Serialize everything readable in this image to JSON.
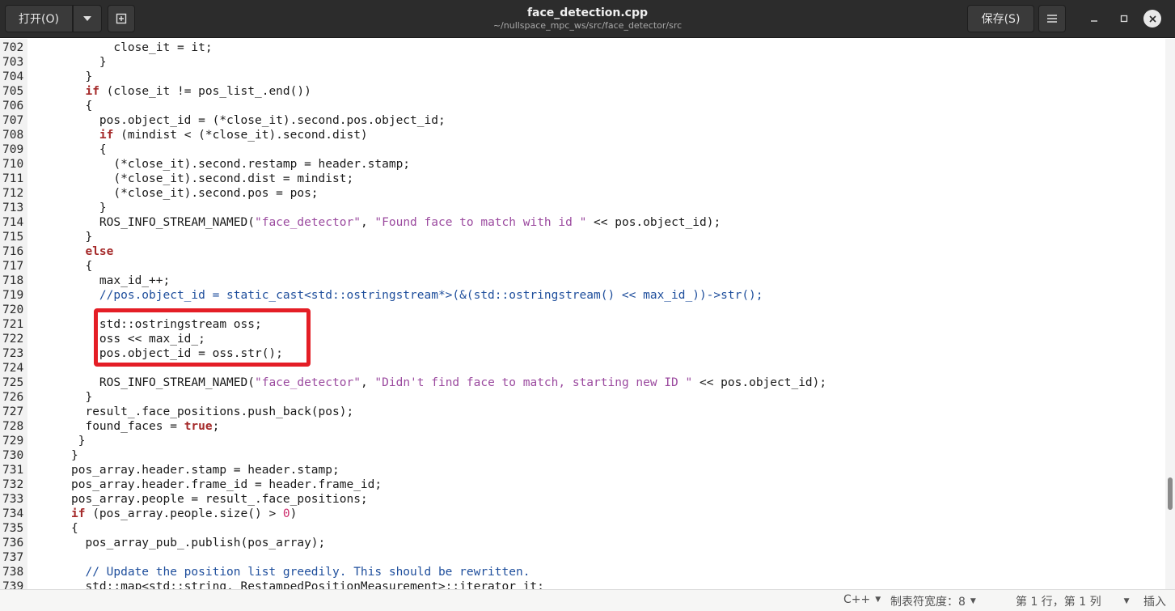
{
  "header": {
    "open_label": "打开(O)",
    "save_label": "保存(S)",
    "title": "face_detection.cpp",
    "subtitle": "~/nullspace_mpc_ws/src/face_detector/src"
  },
  "statusbar": {
    "language": "C++",
    "tab_width": "制表符宽度：8",
    "position": "第 1 行，第 1 列",
    "mode": "插入"
  },
  "editor": {
    "lines": [
      {
        "n": "702",
        "segs": [
          {
            "t": "      close_it = it;"
          }
        ]
      },
      {
        "n": "703",
        "segs": [
          {
            "t": "    }"
          }
        ]
      },
      {
        "n": "704",
        "segs": [
          {
            "t": "  }"
          }
        ]
      },
      {
        "n": "705",
        "segs": [
          {
            "t": "  "
          },
          {
            "t": "if",
            "c": "kw"
          },
          {
            "t": " (close_it != pos_list_.end())"
          }
        ]
      },
      {
        "n": "706",
        "segs": [
          {
            "t": "  {"
          }
        ]
      },
      {
        "n": "707",
        "segs": [
          {
            "t": "    pos.object_id = (*close_it).second.pos.object_id;"
          }
        ]
      },
      {
        "n": "708",
        "segs": [
          {
            "t": "    "
          },
          {
            "t": "if",
            "c": "kw"
          },
          {
            "t": " (mindist < (*close_it).second.dist)"
          }
        ]
      },
      {
        "n": "709",
        "segs": [
          {
            "t": "    {"
          }
        ]
      },
      {
        "n": "710",
        "segs": [
          {
            "t": "      (*close_it).second.restamp = header.stamp;"
          }
        ]
      },
      {
        "n": "711",
        "segs": [
          {
            "t": "      (*close_it).second.dist = mindist;"
          }
        ]
      },
      {
        "n": "712",
        "segs": [
          {
            "t": "      (*close_it).second.pos = pos;"
          }
        ]
      },
      {
        "n": "713",
        "segs": [
          {
            "t": "    }"
          }
        ]
      },
      {
        "n": "714",
        "segs": [
          {
            "t": "    ROS_INFO_STREAM_NAMED("
          },
          {
            "t": "\"face_detector\"",
            "c": "str"
          },
          {
            "t": ", "
          },
          {
            "t": "\"Found face to match with id \"",
            "c": "str"
          },
          {
            "t": " << pos.object_id);"
          }
        ]
      },
      {
        "n": "715",
        "segs": [
          {
            "t": "  }"
          }
        ]
      },
      {
        "n": "716",
        "segs": [
          {
            "t": "  "
          },
          {
            "t": "else",
            "c": "kw"
          }
        ]
      },
      {
        "n": "717",
        "segs": [
          {
            "t": "  {"
          }
        ]
      },
      {
        "n": "718",
        "segs": [
          {
            "t": "    max_id_++;"
          }
        ]
      },
      {
        "n": "719",
        "segs": [
          {
            "t": "    //pos.object_id = static_cast<std::ostringstream*>(&(std::ostringstream() << max_id_))->str();",
            "c": "cmt"
          }
        ]
      },
      {
        "n": "720",
        "segs": [
          {
            "t": ""
          }
        ]
      },
      {
        "n": "721",
        "segs": [
          {
            "t": "    std::ostringstream oss;"
          }
        ]
      },
      {
        "n": "722",
        "segs": [
          {
            "t": "    oss << max_id_;"
          }
        ]
      },
      {
        "n": "723",
        "segs": [
          {
            "t": "    pos.object_id = oss.str();"
          }
        ]
      },
      {
        "n": "724",
        "segs": [
          {
            "t": ""
          }
        ]
      },
      {
        "n": "725",
        "segs": [
          {
            "t": "    ROS_INFO_STREAM_NAMED("
          },
          {
            "t": "\"face_detector\"",
            "c": "str"
          },
          {
            "t": ", "
          },
          {
            "t": "\"Didn't find face to match, starting new ID \"",
            "c": "str"
          },
          {
            "t": " << pos.object_id);"
          }
        ]
      },
      {
        "n": "726",
        "segs": [
          {
            "t": "  }"
          }
        ]
      },
      {
        "n": "727",
        "segs": [
          {
            "t": "  result_.face_positions.push_back(pos);"
          }
        ]
      },
      {
        "n": "728",
        "segs": [
          {
            "t": "  found_faces = "
          },
          {
            "t": "true",
            "c": "kw"
          },
          {
            "t": ";"
          }
        ]
      },
      {
        "n": "729",
        "segs": [
          {
            "t": " }"
          }
        ]
      },
      {
        "n": "730",
        "segs": [
          {
            "t": "}"
          }
        ]
      },
      {
        "n": "731",
        "segs": [
          {
            "t": "pos_array.header.stamp = header.stamp;"
          }
        ]
      },
      {
        "n": "732",
        "segs": [
          {
            "t": "pos_array.header.frame_id = header.frame_id;"
          }
        ]
      },
      {
        "n": "733",
        "segs": [
          {
            "t": "pos_array.people = result_.face_positions;"
          }
        ]
      },
      {
        "n": "734",
        "segs": [
          {
            "t": "if",
            "c": "kw"
          },
          {
            "t": " (pos_array.people.size() > "
          },
          {
            "t": "0",
            "c": "num"
          },
          {
            "t": ")"
          }
        ]
      },
      {
        "n": "735",
        "segs": [
          {
            "t": "{"
          }
        ]
      },
      {
        "n": "736",
        "segs": [
          {
            "t": "  pos_array_pub_.publish(pos_array);"
          }
        ]
      },
      {
        "n": "737",
        "segs": [
          {
            "t": ""
          }
        ]
      },
      {
        "n": "738",
        "segs": [
          {
            "t": "  // Update the position list greedily. This should be rewritten.",
            "c": "cmt"
          }
        ]
      },
      {
        "n": "739",
        "segs": [
          {
            "t": "  std::map<std::string, RestampedPositionMeasurement>::iterator it;"
          }
        ]
      }
    ]
  }
}
